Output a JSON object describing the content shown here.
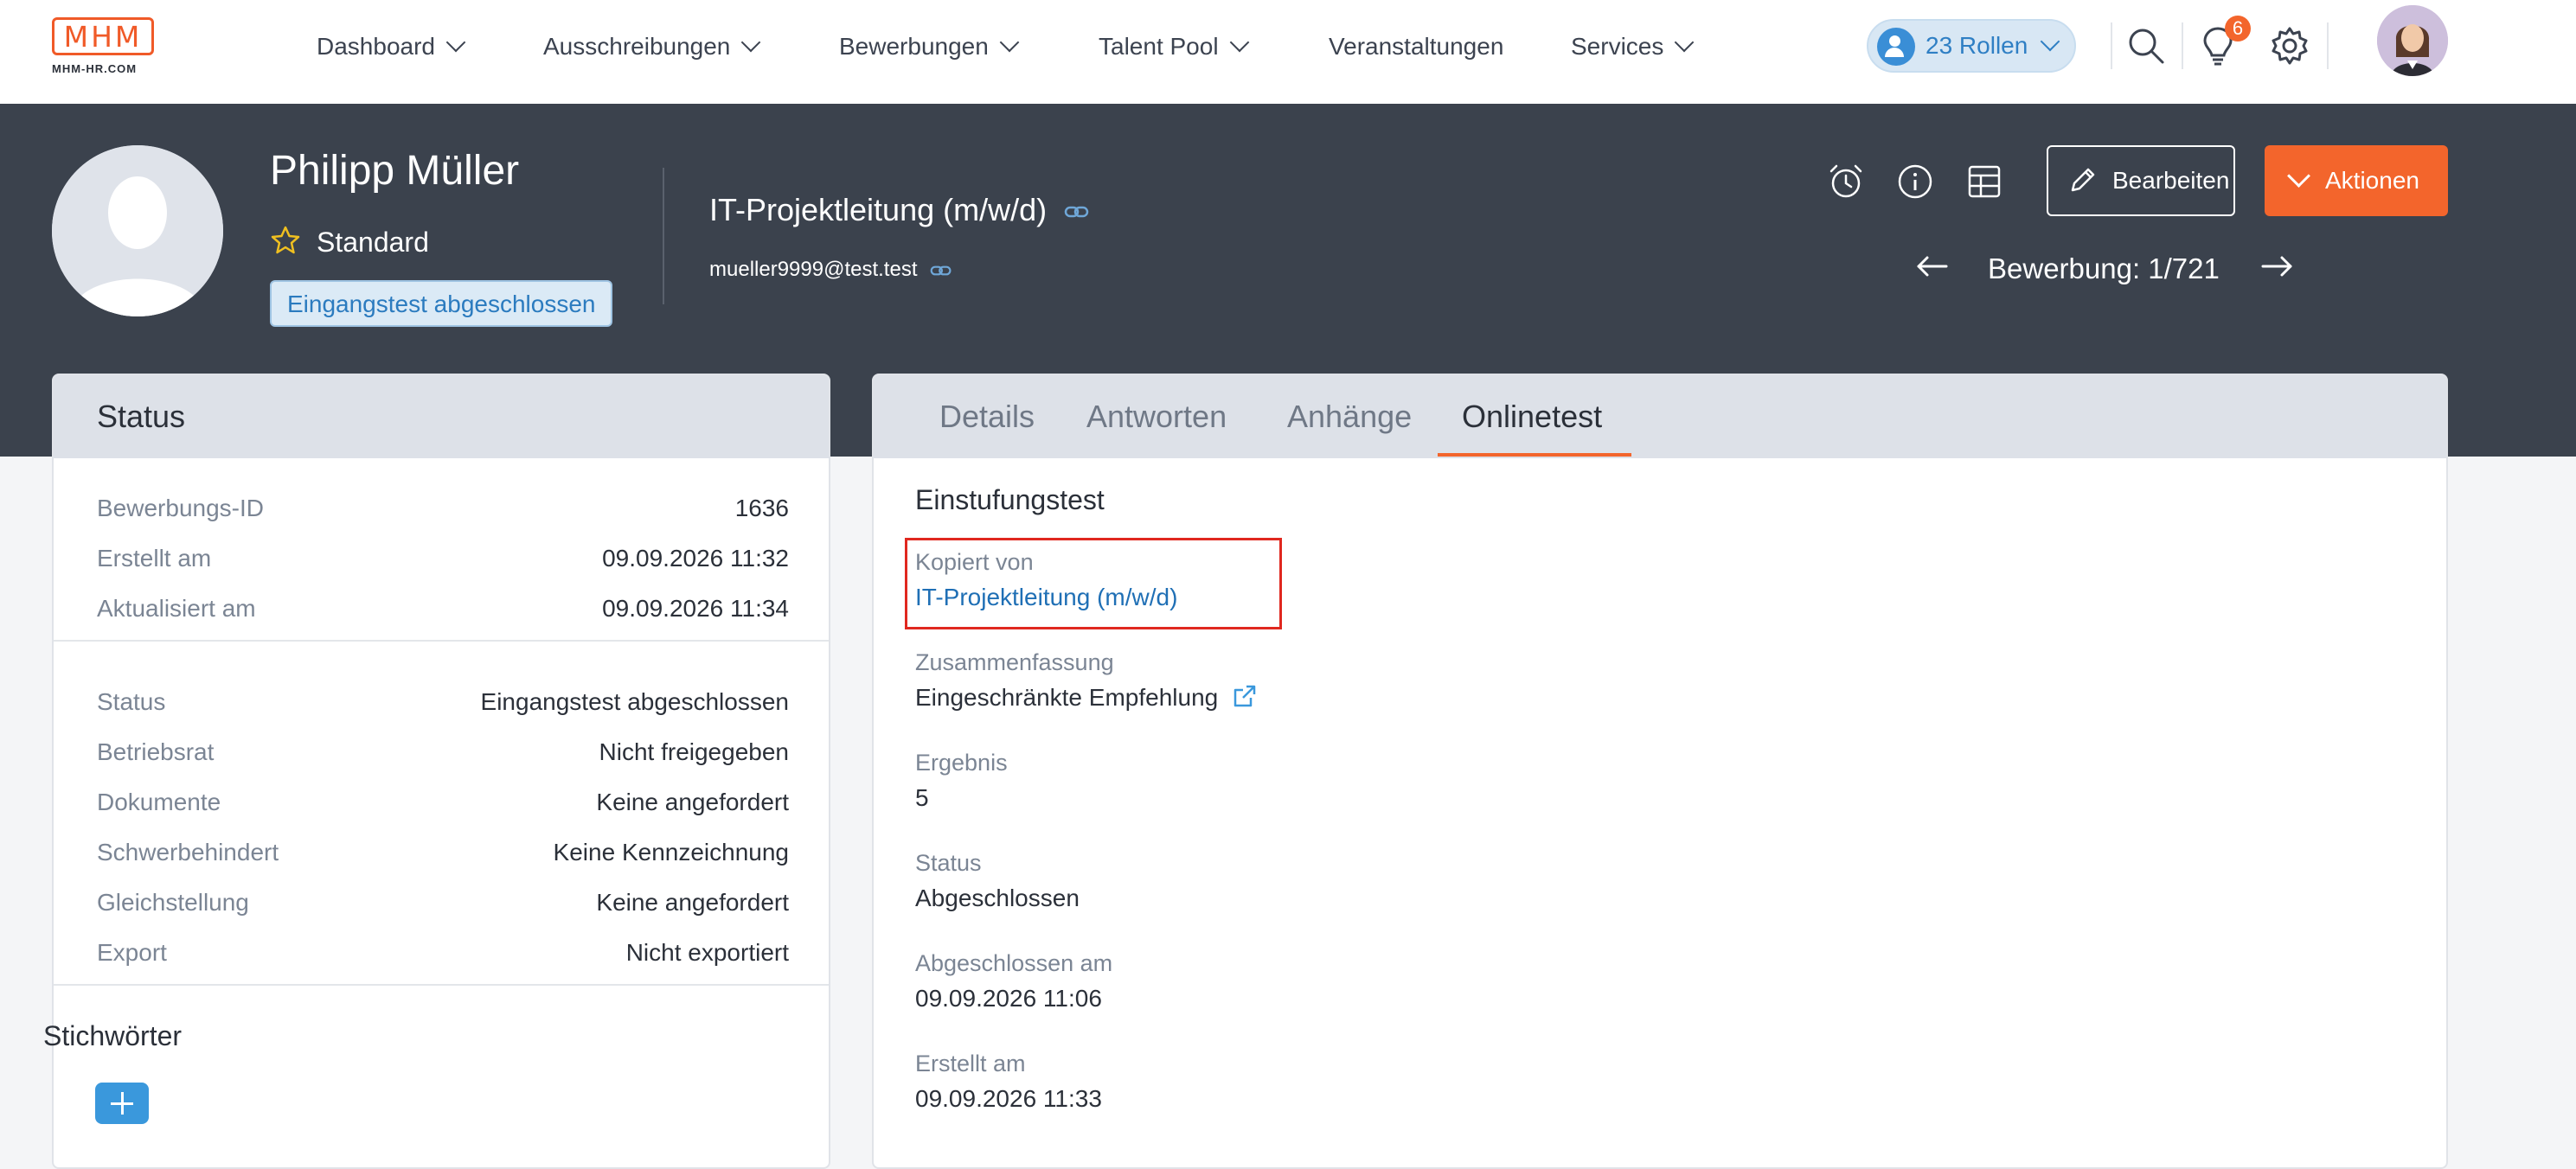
{
  "nav": {
    "logo_text": "MHM",
    "logo_sub": "MHM-HR.COM",
    "items": [
      {
        "label": "Dashboard",
        "dropdown": true
      },
      {
        "label": "Ausschreibungen",
        "dropdown": true
      },
      {
        "label": "Bewerbungen",
        "dropdown": true
      },
      {
        "label": "Talent Pool",
        "dropdown": true
      },
      {
        "label": "Veranstaltungen",
        "dropdown": false
      },
      {
        "label": "Services",
        "dropdown": true
      }
    ],
    "roles_label": "23 Rollen",
    "notification_count": "6",
    "accent_color": "#f3652c"
  },
  "candidate": {
    "name": "Philipp Müller",
    "rating_label": "Standard",
    "status_pill": "Eingangstest abgeschlossen",
    "job_title": "IT-Projektleitung (m/w/d)",
    "email": "mueller9999@test.test"
  },
  "header_actions": {
    "edit_label": "Bearbeiten",
    "actions_label": "Aktionen",
    "pager_label": "Bewerbung: 1/721"
  },
  "status_panel": {
    "title": "Status",
    "group1": [
      {
        "key": "Bewerbungs-ID",
        "value": "1636"
      },
      {
        "key": "Erstellt am",
        "value": "09.09.2026 11:32"
      },
      {
        "key": "Aktualisiert am",
        "value": "09.09.2026 11:34"
      }
    ],
    "group2": [
      {
        "key": "Status",
        "value": "Eingangstest abgeschlossen"
      },
      {
        "key": "Betriebsrat",
        "value": "Nicht freigegeben"
      },
      {
        "key": "Dokumente",
        "value": "Keine angefordert"
      },
      {
        "key": "Schwerbehindert",
        "value": "Keine Kennzeichnung"
      },
      {
        "key": "Gleichstellung",
        "value": "Keine angefordert"
      },
      {
        "key": "Export",
        "value": "Nicht exportiert"
      }
    ],
    "keywords_title": "Stichwörter"
  },
  "tabs": [
    {
      "label": "Details"
    },
    {
      "label": "Antworten"
    },
    {
      "label": "Anhänge"
    },
    {
      "label": "Onlinetest",
      "active": true
    }
  ],
  "onlinetest": {
    "section_title": "Einstufungstest",
    "copied_from_label": "Kopiert von",
    "copied_from_value": "IT-Projektleitung (m/w/d)",
    "summary_label": "Zusammenfassung",
    "summary_value": "Eingeschränkte Empfehlung",
    "result_label": "Ergebnis",
    "result_value": "5",
    "status_label": "Status",
    "status_value": "Abgeschlossen",
    "completed_label": "Abgeschlossen am",
    "completed_value": "09.09.2026 11:06",
    "created_label": "Erstellt am",
    "created_value": "09.09.2026 11:33"
  }
}
